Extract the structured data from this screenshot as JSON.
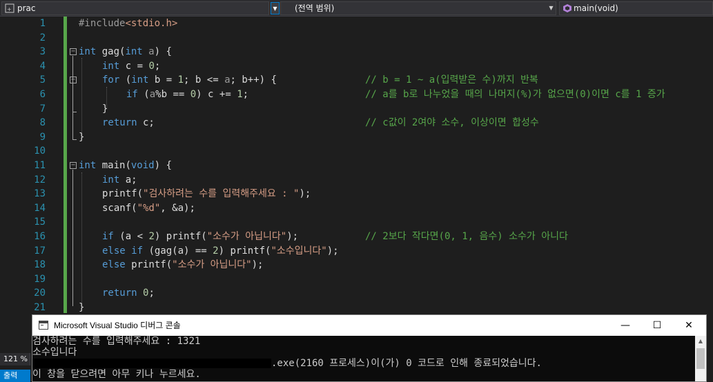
{
  "navbar": {
    "project": "prac",
    "scope": "(전역 범위)",
    "function": "main(void)",
    "dropdown_glyph": "▼"
  },
  "editor": {
    "line_numbers": [
      "1",
      "2",
      "3",
      "4",
      "5",
      "6",
      "7",
      "8",
      "9",
      "10",
      "11",
      "12",
      "13",
      "14",
      "15",
      "16",
      "17",
      "18",
      "19",
      "20",
      "21"
    ],
    "code": {
      "l1_pp": "#include",
      "l1_inc": "<stdio.h>",
      "l3_kw1": "int",
      "l3_fn": " gag(",
      "l3_kw2": "int",
      "l3_par": " a",
      "l3_end": ") {",
      "l4_kw": "int",
      "l4_rest": " c = ",
      "l4_num": "0",
      "l4_end": ";",
      "l5_kw1": "for",
      "l5_a": " (",
      "l5_kw2": "int",
      "l5_b": " b = ",
      "l5_num": "1",
      "l5_c": "; b <= ",
      "l5_par": "a",
      "l5_d": "; b++) {",
      "l5_cm": "// b = 1 ~ a(입력받은 수)까지 반복",
      "l6_kw": "if",
      "l6_a": " (",
      "l6_par": "a",
      "l6_b": "%b == ",
      "l6_num": "0",
      "l6_c": ") c += ",
      "l6_num2": "1",
      "l6_d": ";",
      "l6_cm": "// a를 b로 나누었을 때의 나머지(%)가 없으면(0)이면 c를 1 증가",
      "l7": "}",
      "l8_kw": "return",
      "l8_rest": " c;",
      "l8_cm": "// c값이 2여야 소수, 이상이면 합성수",
      "l9": "}",
      "l11_kw1": "int",
      "l11_fn": " main(",
      "l11_kw2": "void",
      "l11_end": ") {",
      "l12_kw": "int",
      "l12_rest": " a;",
      "l13_fn": "printf(",
      "l13_str": "\"검사하려는 수를 입력해주세요 : \"",
      "l13_end": ");",
      "l14_fn": "scanf(",
      "l14_str": "\"%d\"",
      "l14_end": ", &a);",
      "l16_kw": "if",
      "l16_a": " (a < ",
      "l16_num": "2",
      "l16_b": ") printf(",
      "l16_str": "\"소수가 아닙니다\"",
      "l16_end": ");",
      "l16_cm": "// 2보다 작다면(0, 1, 음수) 소수가 아니다",
      "l17_kw1": "else",
      "l17_sp": " ",
      "l17_kw2": "if",
      "l17_a": " (gag(a) == ",
      "l17_num": "2",
      "l17_b": ") printf(",
      "l17_str": "\"소수입니다\"",
      "l17_end": ");",
      "l18_kw": "else",
      "l18_a": " printf(",
      "l18_str": "\"소수가 아닙니다\"",
      "l18_end": ");",
      "l20_kw": "return",
      "l20_sp": " ",
      "l20_num": "0",
      "l20_end": ";",
      "l21": "}"
    },
    "fold_glyph": "−"
  },
  "status": {
    "zoom": "121 %",
    "output_tab": "출력"
  },
  "console": {
    "title": "Microsoft Visual Studio 디버그 콘솔",
    "minimize": "—",
    "maximize": "☐",
    "close": "✕",
    "lines": [
      "검사하려는 수를 입력해주세요 : 1321",
      "소수입니다",
      ".exe(2160 프로세스)이(가) 0 코드로 인해 종료되었습니다.",
      "이 창을 닫으려면 아무 키나 누르세요."
    ],
    "scroll_up": "▲"
  },
  "colors": {
    "keyword": "#569cd6",
    "comment": "#57a64a",
    "string": "#d69d85",
    "line_number": "#2b91af",
    "accent": "#007acc"
  }
}
